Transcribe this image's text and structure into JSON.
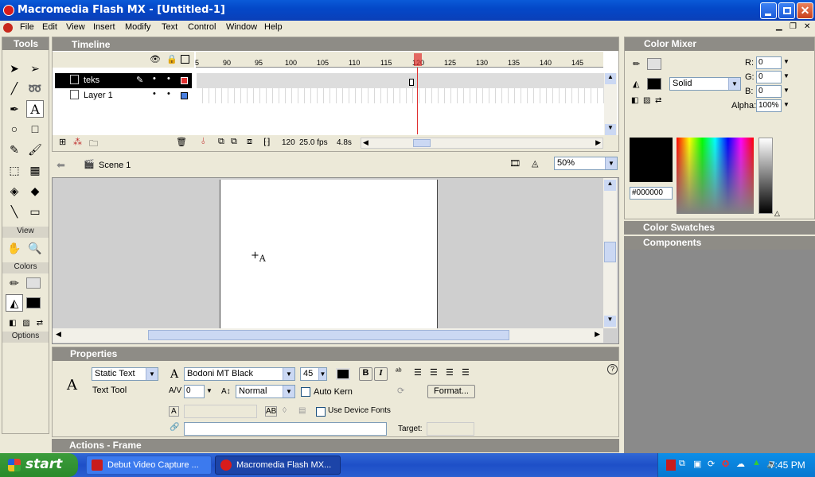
{
  "window": {
    "title": "Macromedia Flash MX - [Untitled-1]"
  },
  "menu": [
    "File",
    "Edit",
    "View",
    "Insert",
    "Modify",
    "Text",
    "Control",
    "Window",
    "Help"
  ],
  "tools": {
    "title": "Tools",
    "view_label": "View",
    "colors_label": "Colors",
    "options_label": "Options"
  },
  "timeline": {
    "title": "Timeline",
    "ruler": [
      "5",
      "90",
      "95",
      "100",
      "105",
      "110",
      "115",
      "120",
      "125",
      "130",
      "135",
      "140",
      "145"
    ],
    "layers": [
      {
        "name": "teks"
      },
      {
        "name": "Layer 1"
      }
    ],
    "current_frame": "120",
    "fps": "25.0 fps",
    "time": "4.8s"
  },
  "stage": {
    "scene": "Scene 1",
    "zoom": "50%"
  },
  "properties": {
    "title": "Properties",
    "text_type": "Static Text",
    "tool_name": "Text Tool",
    "font": "Bodoni MT Black",
    "size": "45",
    "tracking": "0",
    "baseline": "Normal",
    "auto_kern": "Auto Kern",
    "format_button": "Format...",
    "device_fonts": "Use Device Fonts",
    "target_label": "Target:"
  },
  "actions": {
    "title": "Actions - Frame"
  },
  "color_mixer": {
    "title": "Color Mixer",
    "fill_style": "Solid",
    "r_label": "R:",
    "r": "0",
    "g_label": "G:",
    "g": "0",
    "b_label": "B:",
    "b": "0",
    "alpha_label": "Alpha:",
    "alpha": "100%",
    "hex": "#000000"
  },
  "color_swatches": {
    "title": "Color Swatches"
  },
  "components": {
    "title": "Components"
  },
  "taskbar": {
    "start": "start",
    "tasks": [
      "Debut Video Capture ...",
      "Macromedia Flash MX..."
    ],
    "clock": "7:45 PM"
  },
  "colors": {
    "titlebar": "#0a4fd0",
    "taskbar": "#245edb",
    "start": "#3a9a3a",
    "playhead": "#e03030"
  }
}
